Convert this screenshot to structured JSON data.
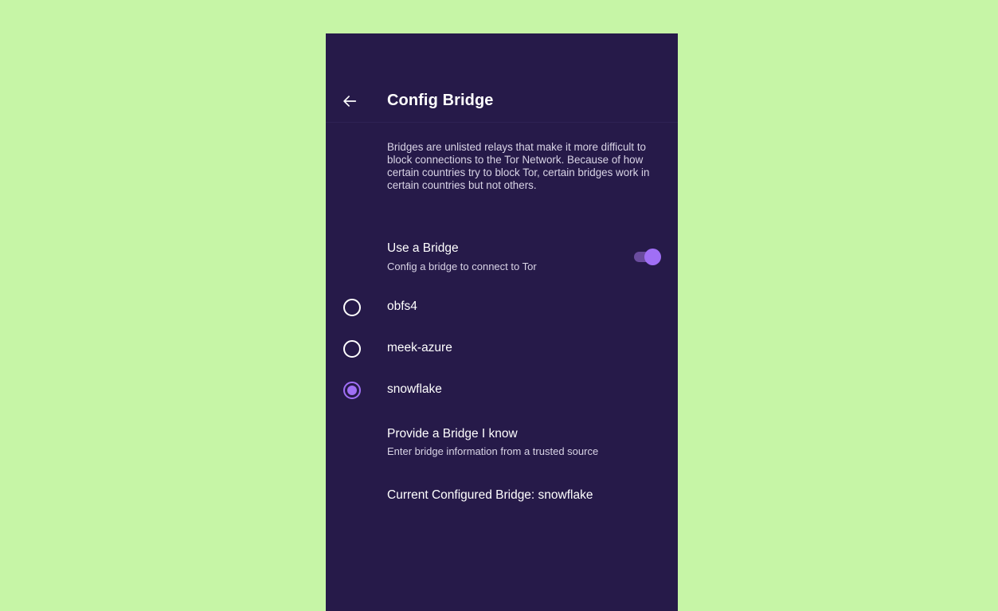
{
  "app_bar": {
    "title": "Config Bridge"
  },
  "description": "Bridges are unlisted relays that make it more difficult to block connections to the Tor Network. Because of how certain countries try to block Tor, certain bridges work in certain countries but not others.",
  "use_bridge": {
    "label": "Use a Bridge",
    "sublabel": "Config a bridge to connect to Tor",
    "enabled": true
  },
  "bridge_options": [
    {
      "label": "obfs4",
      "selected": false
    },
    {
      "label": "meek-azure",
      "selected": false
    },
    {
      "label": "snowflake",
      "selected": true
    }
  ],
  "provide_bridge": {
    "label": "Provide a Bridge I know",
    "sublabel": "Enter bridge information from a trusted source"
  },
  "current_bridge": "Current Configured Bridge: snowflake",
  "colors": {
    "background": "#c6f5a6",
    "surface": "#261a49",
    "accent": "#a06ff5",
    "switch_track": "#6a4c9e",
    "secondary_text": "#d9d4e6"
  },
  "icons": {
    "back": "arrow-left-icon"
  }
}
